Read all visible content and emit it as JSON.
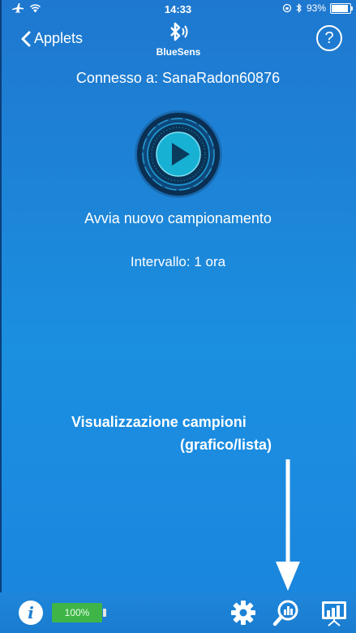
{
  "status_bar": {
    "time": "14:33",
    "battery_percent": "93%",
    "battery_level": 0.93
  },
  "nav": {
    "back_label": "Applets",
    "logo_text": "BlueSens",
    "help_label": "?"
  },
  "main": {
    "connected_text": "Connesso a: SanaRadon60876",
    "start_label": "Avvia nuovo campionamento",
    "interval_text": "Intervallo: 1 ora"
  },
  "annotation": {
    "line1": "Visualizzazione campioni",
    "line2": "(grafico/lista)"
  },
  "toolbar": {
    "info_label": "i",
    "device_battery": "100%",
    "icons": [
      "info-icon",
      "battery-icon",
      "gear-icon",
      "chart-search-icon",
      "presentation-chart-icon"
    ]
  },
  "colors": {
    "background": "#1c86d9",
    "battery_green": "#3fb548",
    "play_accent": "#19b3d6"
  }
}
